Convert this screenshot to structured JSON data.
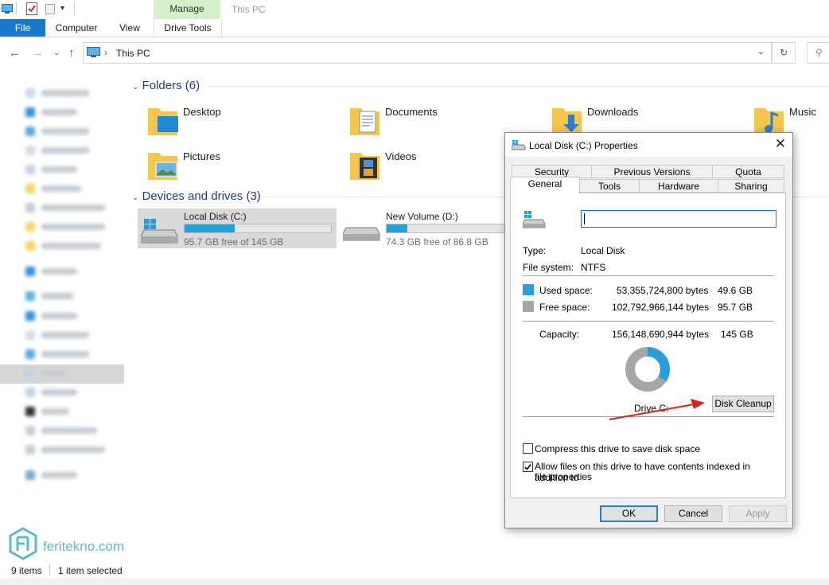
{
  "window": {
    "title": "This PC"
  },
  "ribbon": {
    "tabs": [
      "File",
      "Computer",
      "View",
      "Drive Tools"
    ],
    "contextual_header": "Manage",
    "accent": "#1979ca"
  },
  "address": {
    "path": "This PC"
  },
  "content": {
    "folders_header": "Folders (6)",
    "folders": [
      {
        "label": "Desktop",
        "icon": "desktop-folder-icon"
      },
      {
        "label": "Documents",
        "icon": "documents-folder-icon"
      },
      {
        "label": "Downloads",
        "icon": "downloads-folder-icon"
      },
      {
        "label": "Music",
        "icon": "music-folder-icon"
      },
      {
        "label": "Pictures",
        "icon": "pictures-folder-icon"
      },
      {
        "label": "Videos",
        "icon": "videos-folder-icon"
      }
    ],
    "drives_header": "Devices and drives (3)",
    "drives": [
      {
        "name": "Local Disk (C:)",
        "free_text": "95.7 GB free of 145 GB",
        "used_fraction": 0.34
      },
      {
        "name": "New Volume (D:)",
        "free_text": "74.3 GB free of 86.8 GB",
        "used_fraction": 0.14
      }
    ]
  },
  "status": {
    "items": "9 items",
    "selected": "1 item selected"
  },
  "watermark": {
    "text": "feritekno.com"
  },
  "dialog": {
    "title": "Local Disk (C:) Properties",
    "tabs_back": [
      "Security",
      "Previous Versions",
      "Quota"
    ],
    "tabs_front": [
      "General",
      "Tools",
      "Hardware",
      "Sharing"
    ],
    "name_field": "",
    "type_label": "Type:",
    "type_value": "Local Disk",
    "fs_label": "File system:",
    "fs_value": "NTFS",
    "used_label": "Used space:",
    "used_bytes": "53,355,724,800 bytes",
    "used_gb": "49.6 GB",
    "free_label": "Free space:",
    "free_bytes": "102,792,966,144 bytes",
    "free_gb": "95.7 GB",
    "capacity_label": "Capacity:",
    "capacity_bytes": "156,148,690,944 bytes",
    "capacity_gb": "145 GB",
    "drive_label": "Drive C:",
    "disk_cleanup": "Disk Cleanup",
    "compress_label": "Compress this drive to save disk space",
    "compress_checked": false,
    "index_label_line1": "Allow files on this drive to have contents indexed in addition to",
    "index_label_line2": "file properties",
    "index_checked": true,
    "ok": "OK",
    "cancel": "Cancel",
    "apply": "Apply",
    "used_fraction": 0.342,
    "colors": {
      "used": "#26a0da",
      "free": "#a6a6a6"
    }
  }
}
